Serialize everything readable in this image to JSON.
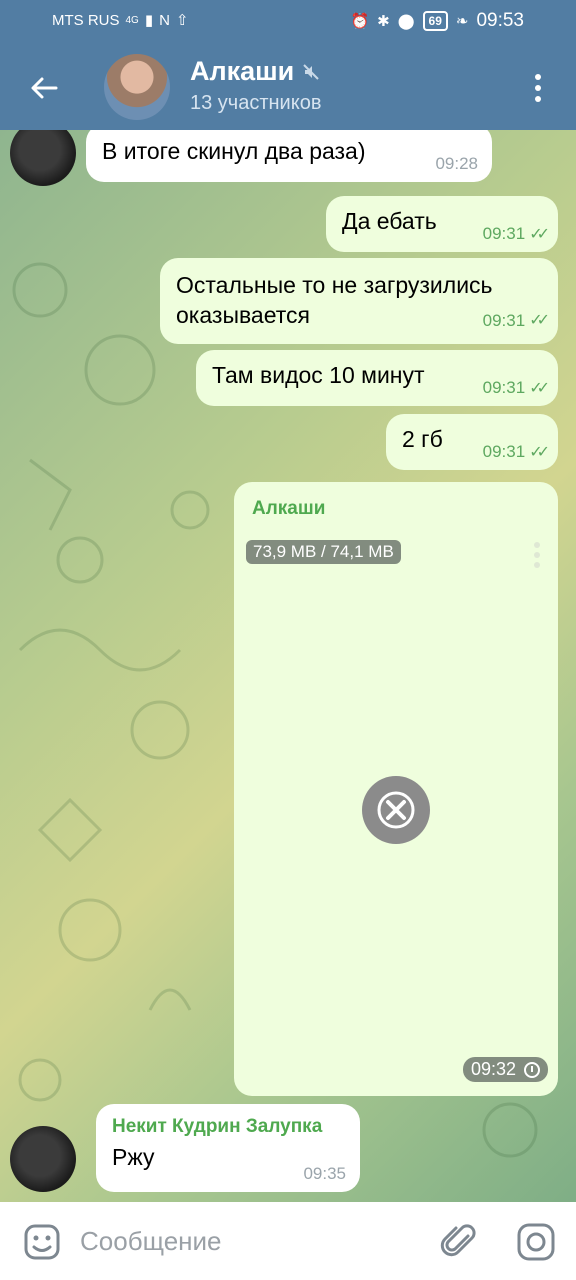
{
  "status_bar": {
    "carrier": "MTS RUS",
    "network": "4G",
    "battery": "69",
    "time": "09:53"
  },
  "header": {
    "title": "Алкаши",
    "subtitle": "13 участников"
  },
  "messages": [
    {
      "dir": "in",
      "text": "В итоге скинул два раза)",
      "time": "09:28"
    },
    {
      "dir": "out",
      "text": "Да ебать",
      "time": "09:31"
    },
    {
      "dir": "out",
      "text": "Остальные то не загрузились оказывается",
      "time": "09:31"
    },
    {
      "dir": "out",
      "text": "Там видос 10 минут",
      "time": "09:31"
    },
    {
      "dir": "out",
      "text": "2 гб",
      "time": "09:31"
    }
  ],
  "media_message": {
    "sender": "Алкаши",
    "size": "73,9 MB / 74,1 MB",
    "time": "09:32"
  },
  "last_message": {
    "sender": "Некит Кудрин Залупка",
    "text": "Ржу",
    "time": "09:35"
  },
  "input": {
    "placeholder": "Сообщение"
  },
  "colors": {
    "header": "#527da3",
    "outgoing_bubble": "#effedd",
    "incoming_bubble": "#ffffff",
    "accent_green": "#5ea860"
  }
}
